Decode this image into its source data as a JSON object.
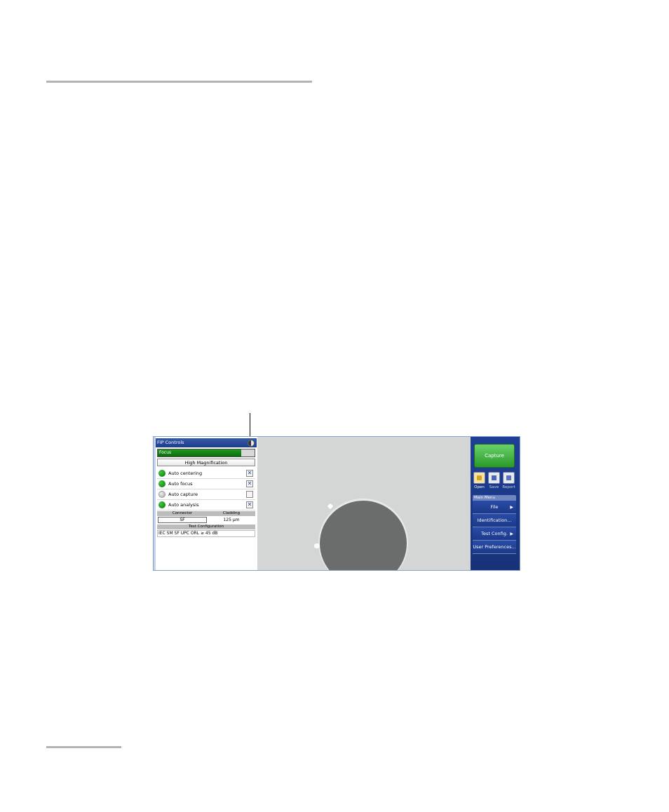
{
  "fip_controls": {
    "title": "FIP Controls",
    "focus_label": "Focus",
    "focus_level": 0.86,
    "magnification_button": "High Magnification",
    "options": [
      {
        "label": "Auto centering",
        "status": "green",
        "checked": true
      },
      {
        "label": "Auto focus",
        "status": "green",
        "checked": true
      },
      {
        "label": "Auto capture",
        "status": "grey",
        "checked": false
      },
      {
        "label": "Auto analysis",
        "status": "green",
        "checked": true
      }
    ],
    "checked_glyph": "✕",
    "connector_header": "Connector",
    "cladding_header": "Cladding",
    "connector_value": "SF",
    "cladding_value": "125 µm",
    "test_config_header": "Test Configuration",
    "test_config_value": "IEC SM SF UPC ORL ≥ 45 dB"
  },
  "right_panel": {
    "capture_label": "Capture",
    "tools": [
      {
        "label": "Open",
        "icon": "open-folder-icon",
        "active": true
      },
      {
        "label": "Save",
        "icon": "save-disk-icon",
        "active": false
      },
      {
        "label": "Report",
        "icon": "report-icon",
        "active": false
      }
    ],
    "main_menu_title": "Main Menu",
    "menu_items": [
      {
        "label": "File",
        "submenu": true
      },
      {
        "label": "Identification...",
        "submenu": false
      },
      {
        "label": "Test Config.",
        "submenu": true
      },
      {
        "label": "User Preferences...",
        "submenu": false
      }
    ],
    "submenu_glyph": "▶"
  },
  "colors": {
    "header_blue": "#1d3d8c",
    "focus_green": "#0b6c0b",
    "capture_green": "#2a9a2a",
    "panel_blue": "#173278",
    "rule_grey": "#b3b3b3"
  }
}
